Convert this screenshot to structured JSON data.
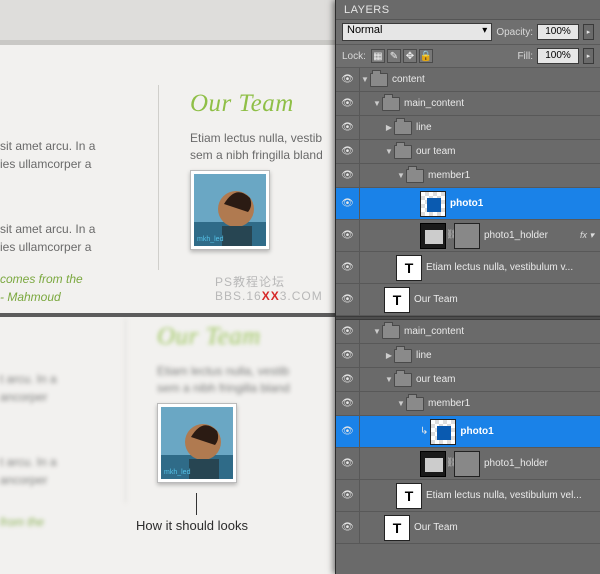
{
  "panel": {
    "title": "LAYERS",
    "blend_mode": "Normal",
    "opacity_label": "Opacity:",
    "opacity_value": "100%",
    "lock_label": "Lock:",
    "fill_label": "Fill:",
    "fill_value": "100%",
    "lock_icons": [
      "transparency-lock-icon",
      "pixel-lock-icon",
      "position-lock-icon",
      "all-lock-icon"
    ]
  },
  "layers": [
    {
      "kind": "group",
      "indent": 0,
      "arrow": "▼",
      "name": "content"
    },
    {
      "kind": "group",
      "indent": 1,
      "arrow": "▼",
      "name": "main_content"
    },
    {
      "kind": "group",
      "indent": 2,
      "arrow": "▶",
      "name": "line"
    },
    {
      "kind": "group",
      "indent": 2,
      "arrow": "▼",
      "name": "our team"
    },
    {
      "kind": "group",
      "indent": 3,
      "arrow": "▼",
      "name": "member1"
    },
    {
      "kind": "sel",
      "indent": 5,
      "thumb": "trans",
      "name": "photo1"
    },
    {
      "kind": "layer",
      "indent": 5,
      "thumb": "mask",
      "link": true,
      "name": "photo1_holder",
      "fx": "fx ▾"
    },
    {
      "kind": "layer",
      "indent": 3,
      "thumb": "T",
      "name": "Etiam lectus nulla, vestibulum v..."
    },
    {
      "kind": "layer",
      "indent": 2,
      "thumb": "T",
      "name": "Our Team"
    },
    {
      "kind": "sep"
    },
    {
      "kind": "group",
      "indent": 1,
      "arrow": "▼",
      "name": "main_content"
    },
    {
      "kind": "group",
      "indent": 2,
      "arrow": "▶",
      "name": "line"
    },
    {
      "kind": "group",
      "indent": 2,
      "arrow": "▼",
      "name": "our team"
    },
    {
      "kind": "group",
      "indent": 3,
      "arrow": "▼",
      "name": "member1"
    },
    {
      "kind": "sel",
      "indent": 5,
      "thumb": "trans",
      "name": "photo1",
      "clip": true
    },
    {
      "kind": "layer",
      "indent": 5,
      "thumb": "mask",
      "link": true,
      "name": "photo1_holder"
    },
    {
      "kind": "layer",
      "indent": 3,
      "thumb": "T",
      "name": "Etiam lectus nulla, vestibulum vel..."
    },
    {
      "kind": "layer",
      "indent": 2,
      "thumb": "T",
      "name": "Our Team"
    }
  ],
  "site": {
    "title": "Our Team",
    "frag1_a": "sit amet arcu. In a",
    "frag1_b": "ies ullamcorper a",
    "quote_a": "comes from the",
    "quote_b": "- Mahmoud",
    "lead_a": "Etiam lectus nulla, vestib",
    "lead_b": "sem a nibh fringilla bland",
    "photo_tag": "mkh_led",
    "bot_frag1_a": "t arcu. In a",
    "bot_frag1_b": "ancorper",
    "bot_quote": "from the",
    "caption": "How it should looks"
  },
  "watermark": {
    "line1": "PS教程论坛",
    "pref": "BBS.16",
    "mid": "XX",
    "suf": "3.COM"
  }
}
